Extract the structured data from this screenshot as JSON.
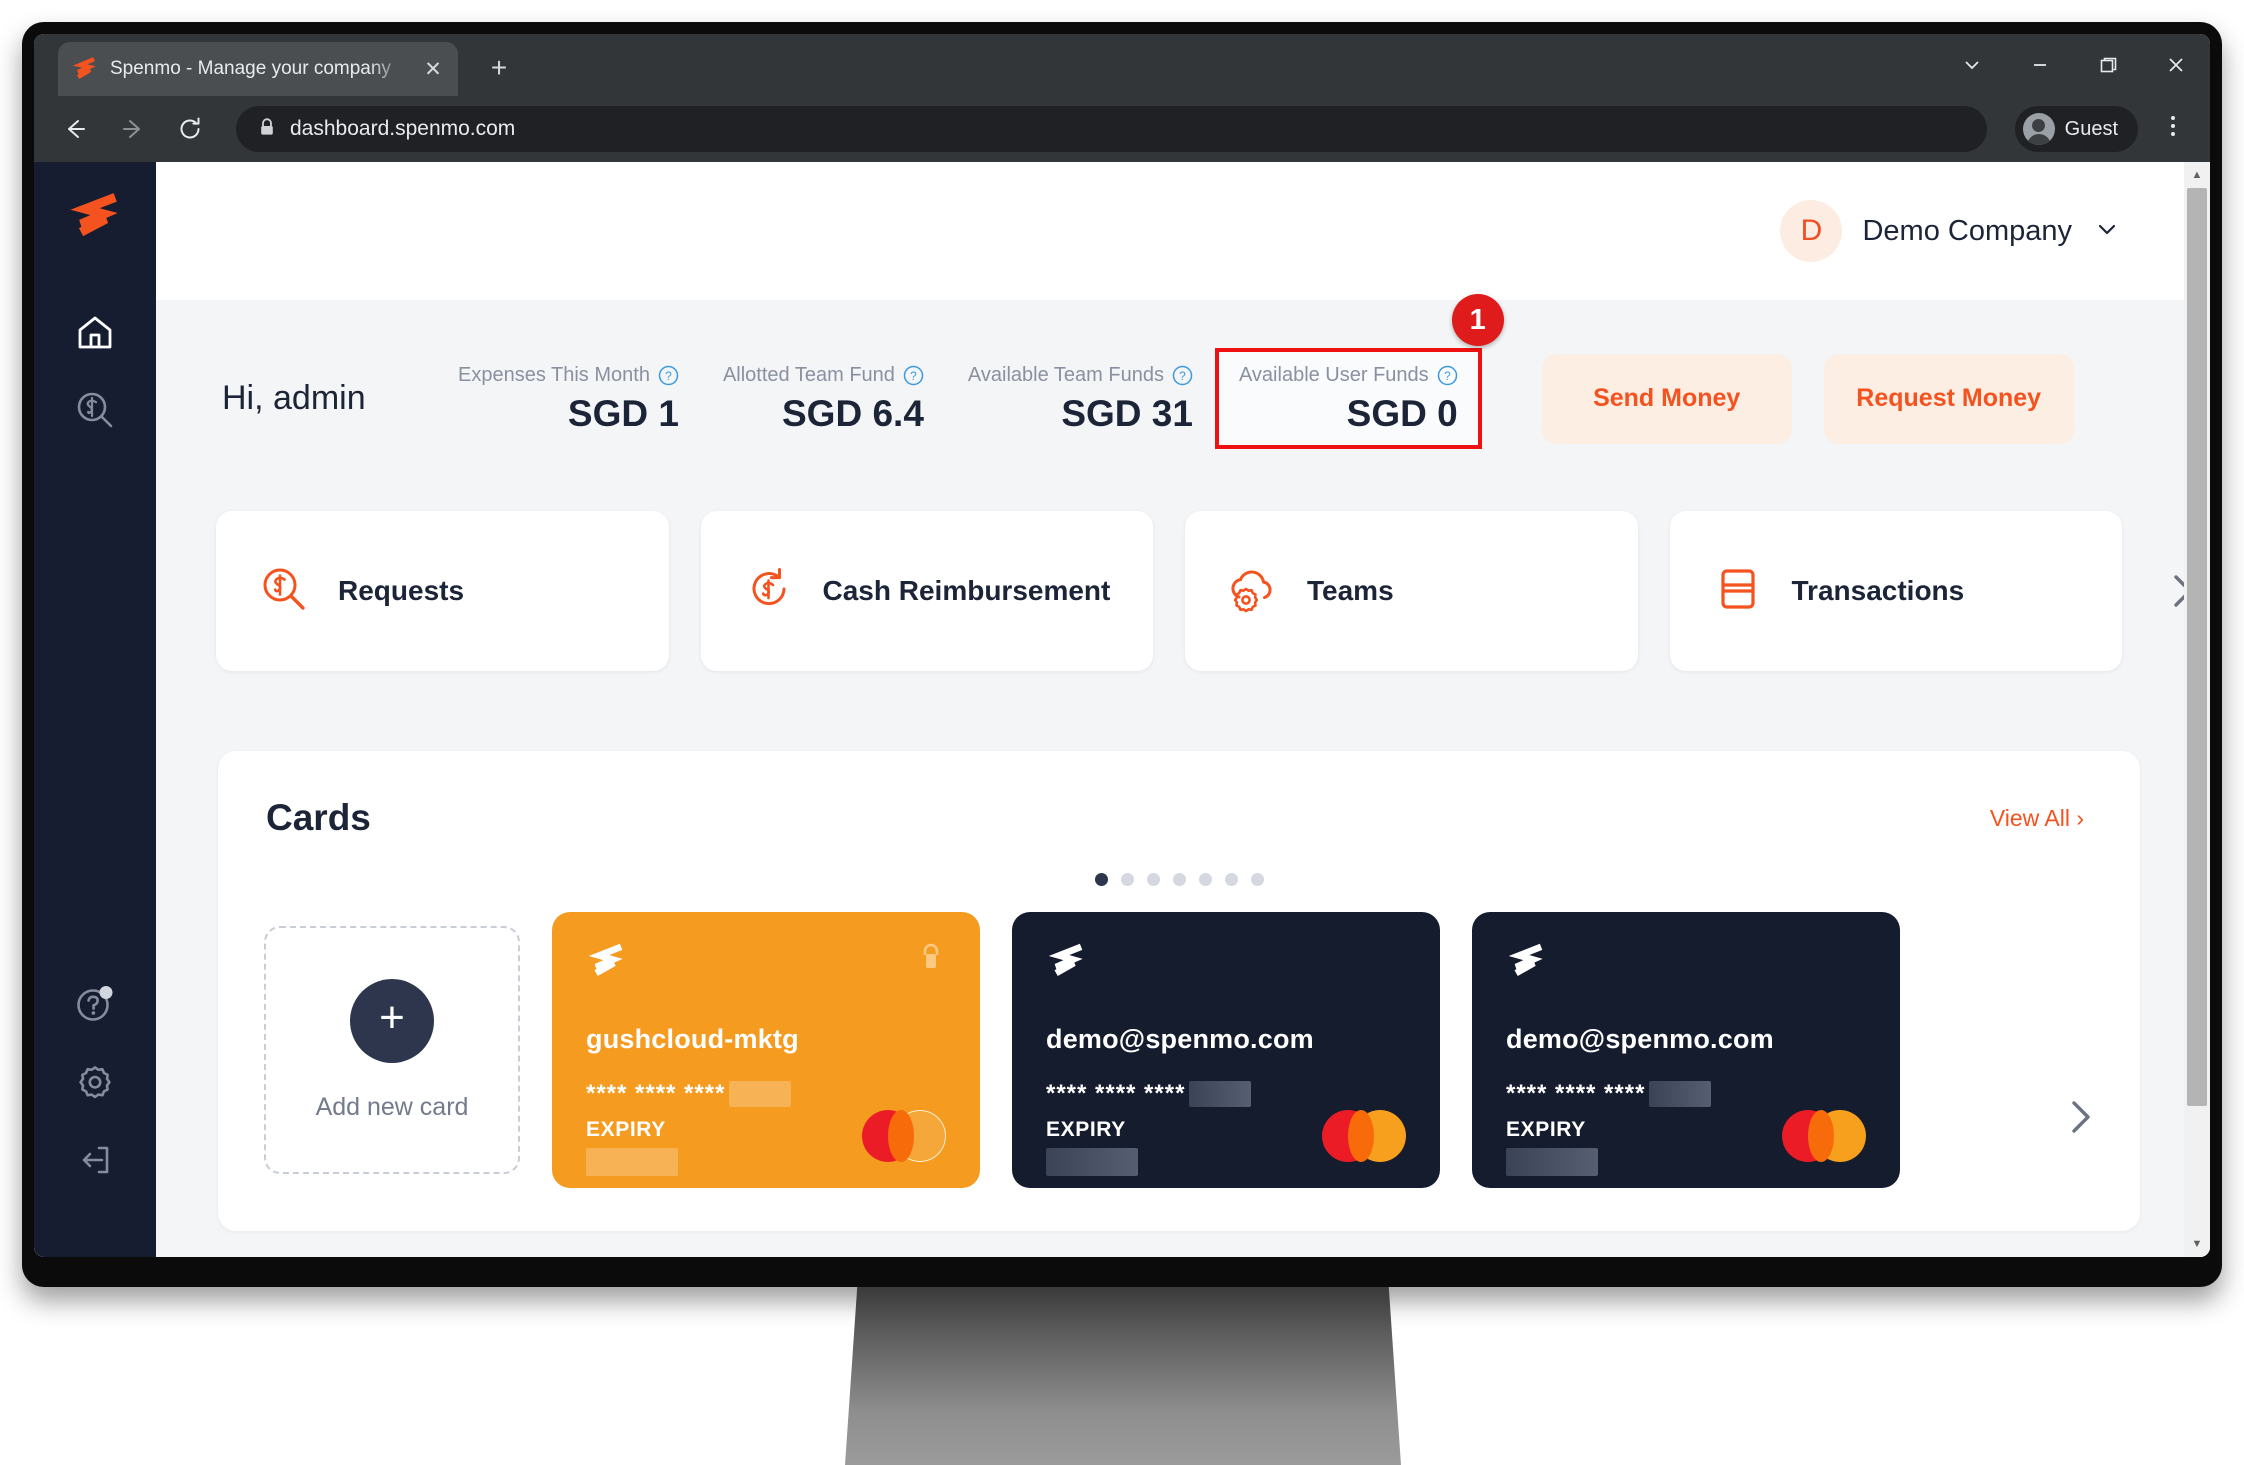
{
  "browser": {
    "tab": {
      "title": "Spenmo - Manage your company",
      "favicon": "spenmo-logo-icon",
      "close_icon": "close-icon"
    },
    "new_tab_icon": "plus-icon",
    "window_controls": [
      {
        "name": "chevron-down-icon",
        "glyph": "∨"
      },
      {
        "name": "minimize-icon",
        "glyph": "—"
      },
      {
        "name": "maximize-icon",
        "glyph": "❐"
      },
      {
        "name": "close-icon",
        "glyph": "✕"
      }
    ],
    "back_icon": "back-arrow-icon",
    "forward_icon": "forward-arrow-icon",
    "reload_icon": "reload-icon",
    "url": "dashboard.spenmo.com",
    "lock_icon": "lock-icon",
    "profile_label": "Guest",
    "menu_icon": "kebab-menu-icon"
  },
  "sidebar": {
    "brand": "spenmo-logo-icon",
    "items": [
      {
        "name": "home",
        "icon": "home-icon",
        "active": true
      },
      {
        "name": "requests",
        "icon": "money-search-icon",
        "active": false
      }
    ],
    "bottom_items": [
      {
        "name": "help",
        "icon": "help-circle-icon",
        "badge": true
      },
      {
        "name": "settings",
        "icon": "gear-icon",
        "badge": false
      },
      {
        "name": "logout",
        "icon": "logout-icon",
        "badge": false
      }
    ]
  },
  "topbar": {
    "org_initial": "D",
    "org_name": "Demo Company",
    "chevron_icon": "chevron-down-icon"
  },
  "overview": {
    "greeting": "Hi, admin",
    "metrics": [
      {
        "label": "Expenses This Month",
        "value": "SGD 1",
        "highlighted": false
      },
      {
        "label": "Allotted Team Fund",
        "value": "SGD 6.4",
        "highlighted": false
      },
      {
        "label": "Available Team Funds",
        "value": "SGD 31",
        "highlighted": false
      },
      {
        "label": "Available User Funds",
        "value": "SGD 0",
        "highlighted": true
      }
    ],
    "annotation_badge": "1",
    "send_money_label": "Send Money",
    "request_money_label": "Request Money"
  },
  "quick_tiles": [
    {
      "label": "Requests",
      "icon": "money-search-icon"
    },
    {
      "label": "Cash Reimbursement",
      "icon": "refresh-money-icon"
    },
    {
      "label": "Teams",
      "icon": "cloud-gear-icon"
    },
    {
      "label": "Transactions",
      "icon": "transactions-icon"
    }
  ],
  "quick_tiles_next_icon": "chevron-right-icon",
  "cards_section": {
    "title": "Cards",
    "view_all_label": "View All ›",
    "dots_total": 7,
    "dots_active_index": 0,
    "add_new_card_label": "Add new card",
    "add_new_card_icon": "plus-icon",
    "next_icon": "chevron-right-icon",
    "items": [
      {
        "name": "gushcloud-mktg",
        "theme": "orange",
        "masked_number": "**** **** ****",
        "expiry_label": "EXPIRY",
        "locked": true,
        "network_icon": "mastercard-icon"
      },
      {
        "name": "demo@spenmo.com",
        "theme": "dark",
        "masked_number": "**** **** ****",
        "expiry_label": "EXPIRY",
        "locked": false,
        "network_icon": "mastercard-icon"
      },
      {
        "name": "demo@spenmo.com",
        "theme": "dark",
        "masked_number": "**** **** ****",
        "expiry_label": "EXPIRY",
        "locked": false,
        "network_icon": "mastercard-icon"
      }
    ]
  },
  "colors": {
    "brand_orange": "#f4521f",
    "card_orange": "#f59c20",
    "sidebar_navy": "#161d31",
    "annotation_red": "#ee1111",
    "page_bg": "#f4f5f7"
  }
}
